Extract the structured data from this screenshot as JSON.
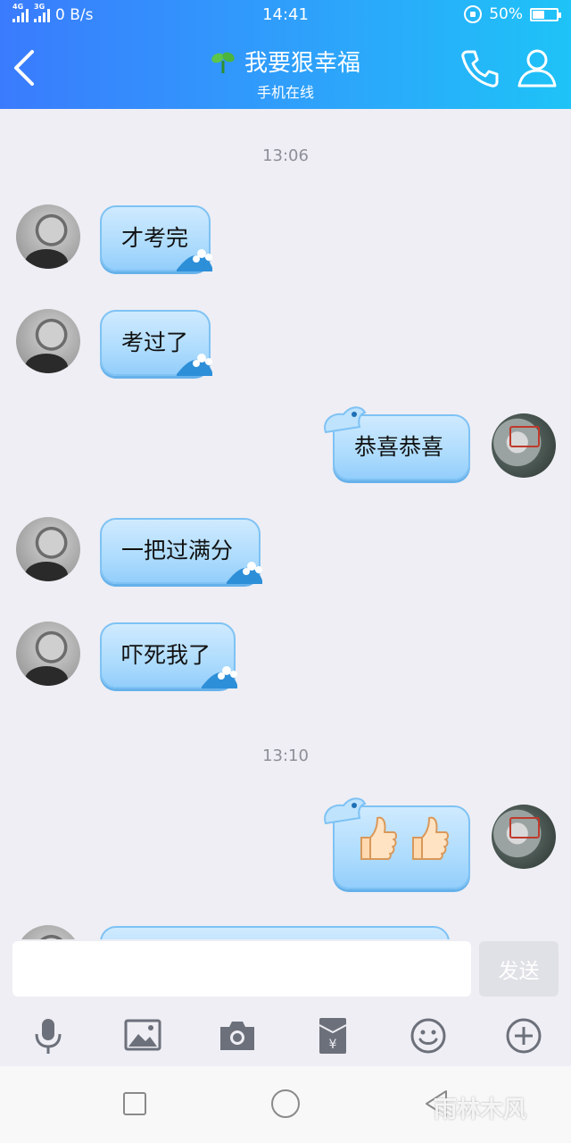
{
  "status_bar": {
    "net_tag_1": "4G",
    "net_tag_2": "3G",
    "speed": "0 B/s",
    "time": "14:41",
    "battery_text": "50%",
    "battery_level": 0.5
  },
  "header": {
    "title": "我要狠幸福",
    "subtitle": "手机在线"
  },
  "chat": {
    "timestamps": [
      "13:06",
      "13:10"
    ],
    "messages": [
      {
        "side": "received",
        "text": "才考完"
      },
      {
        "side": "received",
        "text": "考过了"
      },
      {
        "side": "sent",
        "text": "恭喜恭喜"
      },
      {
        "side": "received",
        "text": "一把过满分"
      },
      {
        "side": "received",
        "text": "吓死我了"
      },
      {
        "side": "sent",
        "emoji": [
          "thumbs-up",
          "thumbs-up"
        ]
      }
    ]
  },
  "input": {
    "value": "",
    "send_label": "发送"
  },
  "toolbar": {
    "icons": [
      "microphone-icon",
      "image-icon",
      "camera-icon",
      "red-packet-icon",
      "emoji-icon",
      "plus-icon"
    ]
  },
  "navbar": {
    "icons": [
      "recent-apps-icon",
      "home-icon",
      "back-triangle-icon"
    ]
  },
  "watermark": "雨林木风",
  "colors": {
    "header_start": "#3a7bfd",
    "header_end": "#1ec3f7",
    "bubble": "#aedcfd",
    "background": "#eeeef4"
  }
}
